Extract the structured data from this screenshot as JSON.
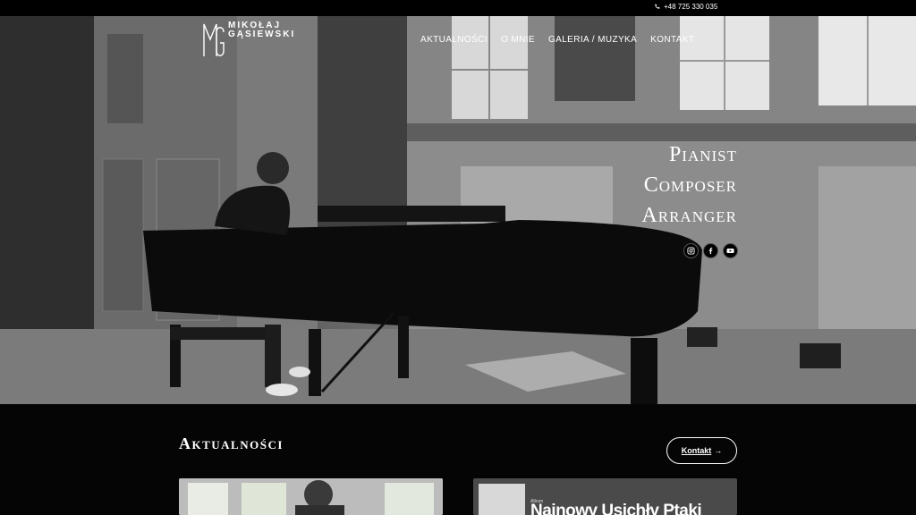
{
  "topbar": {
    "phone": "+48 725 330 035",
    "phone_icon": "phone-icon"
  },
  "logo": {
    "line1": "MIKOŁAJ",
    "line2": "GĄSIEWSKI",
    "mark": "MG"
  },
  "nav": {
    "items": [
      {
        "label": "AKTUALNOŚCI"
      },
      {
        "label": "O MNIE"
      },
      {
        "label": "GALERIA / MUZYKA"
      },
      {
        "label": "KONTAKT"
      }
    ]
  },
  "hero": {
    "tagline": [
      "Pianist",
      "Composer",
      "Arranger"
    ],
    "socials": [
      "instagram-icon",
      "facebook-icon",
      "youtube-icon"
    ]
  },
  "news": {
    "title": "Aktualności",
    "button": {
      "label": "Kontakt",
      "arrow": "→"
    },
    "card2": {
      "label": "Album",
      "headline": "Najnowy Usichły Ptaki"
    }
  }
}
